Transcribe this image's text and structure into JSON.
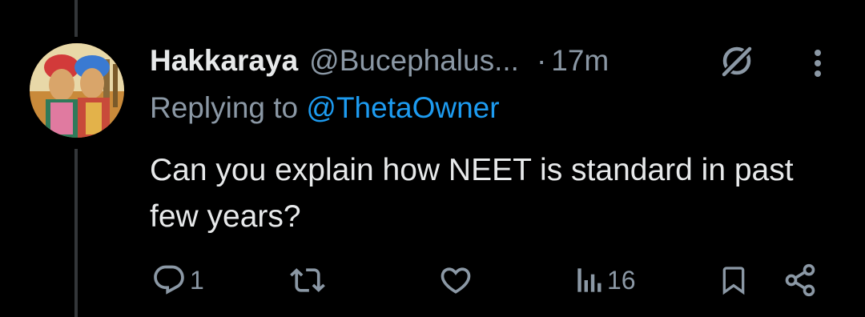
{
  "tweet": {
    "author_name": "Hakkaraya",
    "author_handle": "@Bucephalus...",
    "separator": "·",
    "time": "17m",
    "reply_prefix": "Replying to",
    "reply_to": "@ThetaOwner",
    "text": "Can you explain how NEET is standard in past few years?"
  },
  "actions": {
    "reply_count": "1",
    "retweet_count": "",
    "like_count": "",
    "view_count": "16"
  },
  "icons": {
    "reply": "reply-icon",
    "retweet": "retweet-icon",
    "like": "heart-icon",
    "views": "views-icon",
    "bookmark": "bookmark-icon",
    "share": "share-icon",
    "grok": "grok-icon",
    "more": "more-icon"
  },
  "colors": {
    "background": "#000000",
    "text_primary": "#e7e9ea",
    "text_secondary": "#8b98a5",
    "link": "#1d9bf0",
    "thread_line": "#333639"
  }
}
